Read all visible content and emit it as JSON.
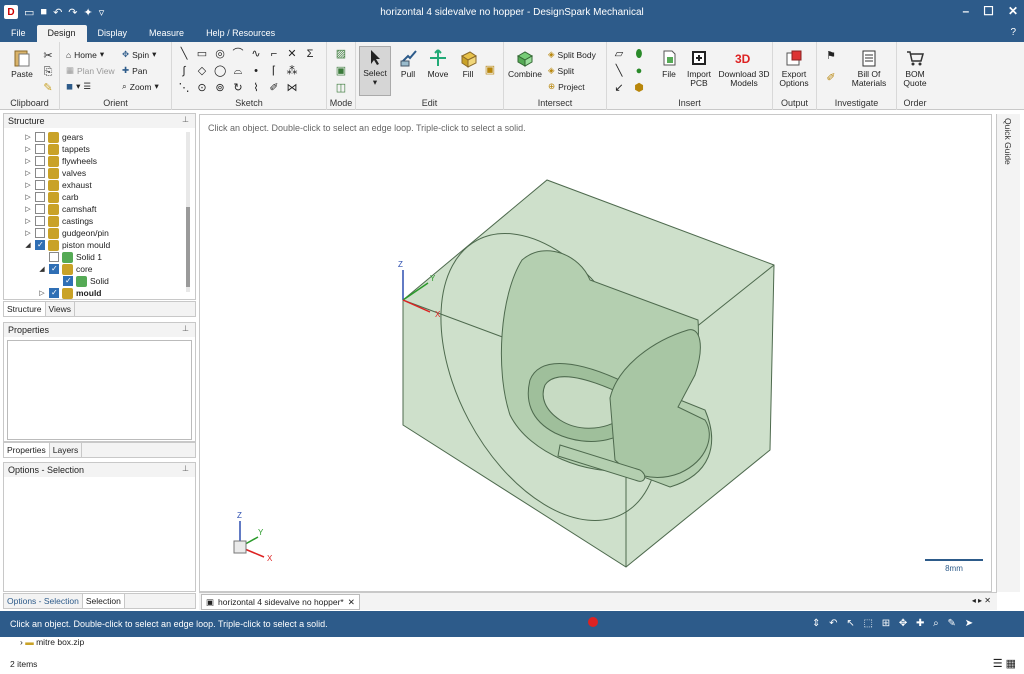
{
  "window": {
    "title": "horizontal 4 sidevalve no hopper - DesignSpark Mechanical",
    "minimize": "–",
    "maximize": "☐",
    "close": "✕"
  },
  "menu": {
    "tabs": [
      "File",
      "Design",
      "Display",
      "Measure",
      "Help / Resources"
    ],
    "active": "Design",
    "help_glyph": "?"
  },
  "ribbon": {
    "clipboard": {
      "label": "Clipboard",
      "paste": "Paste"
    },
    "orient": {
      "label": "Orient",
      "home": "Home",
      "spin": "Spin",
      "plan_view": "Plan View",
      "pan": "Pan",
      "zoom": "Zoom"
    },
    "sketch": {
      "label": "Sketch"
    },
    "mode": {
      "label": "Mode"
    },
    "edit": {
      "label": "Edit",
      "select": "Select",
      "pull": "Pull",
      "move": "Move",
      "fill": "Fill"
    },
    "intersect": {
      "label": "Intersect",
      "combine": "Combine",
      "split_body": "Split Body",
      "split": "Split",
      "project": "Project"
    },
    "insert": {
      "label": "Insert",
      "file": "File",
      "import_pcb": "Import PCB",
      "download_3d": "Download 3D Models"
    },
    "output": {
      "label": "Output",
      "export": "Export Options"
    },
    "investigate": {
      "label": "Investigate",
      "bom": "Bill Of Materials"
    },
    "order": {
      "label": "Order",
      "bom_quote": "BOM Quote"
    }
  },
  "structure": {
    "title": "Structure",
    "items": [
      {
        "label": "gears",
        "checked": false
      },
      {
        "label": "tappets",
        "checked": false
      },
      {
        "label": "flywheels",
        "checked": false
      },
      {
        "label": "valves",
        "checked": false
      },
      {
        "label": "exhaust",
        "checked": false
      },
      {
        "label": "carb",
        "checked": false
      },
      {
        "label": "camshaft",
        "checked": false
      },
      {
        "label": "castings",
        "checked": false
      },
      {
        "label": "gudgeon/pin",
        "checked": false
      },
      {
        "label": "piston mould",
        "checked": true
      },
      {
        "label": "Solid 1",
        "checked": false
      },
      {
        "label": "core",
        "checked": true
      },
      {
        "label": "Solid",
        "checked": true
      },
      {
        "label": "mould",
        "checked": true
      }
    ],
    "tabs": [
      "Structure",
      "Views"
    ]
  },
  "properties": {
    "title": "Properties",
    "tabs": [
      "Properties",
      "Layers"
    ]
  },
  "options": {
    "title": "Options - Selection",
    "tabs": [
      "Options - Selection",
      "Selection"
    ]
  },
  "viewport": {
    "hint": "Click an object. Double-click to select an edge loop. Triple-click to select a solid.",
    "scale": "8mm",
    "axes": {
      "x": "X",
      "y": "Y",
      "z": "Z"
    }
  },
  "quick_guide": "Quick Guide",
  "document_tab": "horizontal 4 sidevalve no hopper*",
  "status": {
    "text": "Click an object. Double-click to select an edge loop. Triple-click to select a solid."
  },
  "explorer": {
    "file": "mitre box.zip",
    "count": "2 items"
  },
  "colors": {
    "accent": "#2d5b8a",
    "solid_fill": "#c3d9bf",
    "solid_edge": "#4e6a4e"
  }
}
